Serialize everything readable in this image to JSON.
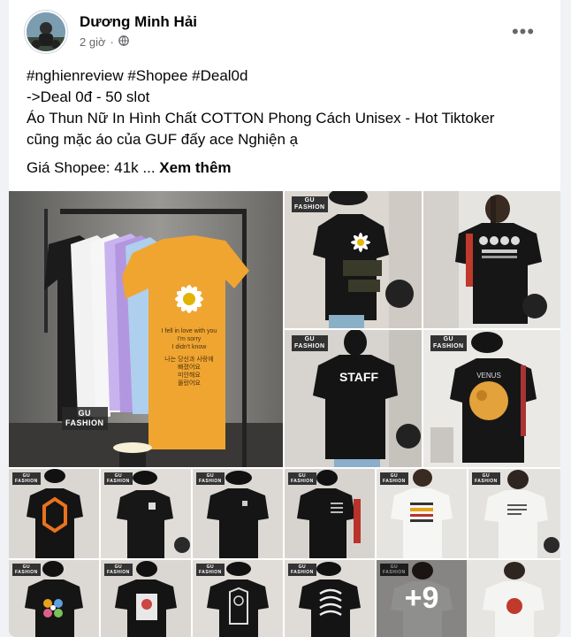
{
  "post": {
    "author": "Dương Minh Hải",
    "time": "2 giờ",
    "more_label": "•••",
    "lines": [
      "#nghienreview #Shopee #Deal0d",
      "->Deal 0đ - 50 slot",
      "Áo Thun Nữ In Hình Chất COTTON Phong Cách Unisex - Hot Tiktoker",
      "cũng mặc áo của GUF đấy ace Nghiện ạ"
    ],
    "price_text": "Giá Shopee: 41k ... ",
    "see_more": "Xem thêm"
  },
  "photos": {
    "main_watermark": "GU\nFASHION",
    "small_watermark": "GU\nFASHION",
    "shirt_print_lines": [
      "I fell in love with you",
      "I'm sorry",
      "I didn't know",
      "나는 당신과 사랑에",
      "빠졌어요",
      "미안해요",
      "몰랐어요"
    ],
    "staff_text": "STAFF",
    "venus_text": "VENUS",
    "extra_count": "+9"
  },
  "colors": {
    "link": "#050505",
    "meta": "#65676b",
    "shirt_yellow": "#f0a531",
    "shirt_purple": "#b9a0e6",
    "shirt_blue": "#a9cbea"
  }
}
